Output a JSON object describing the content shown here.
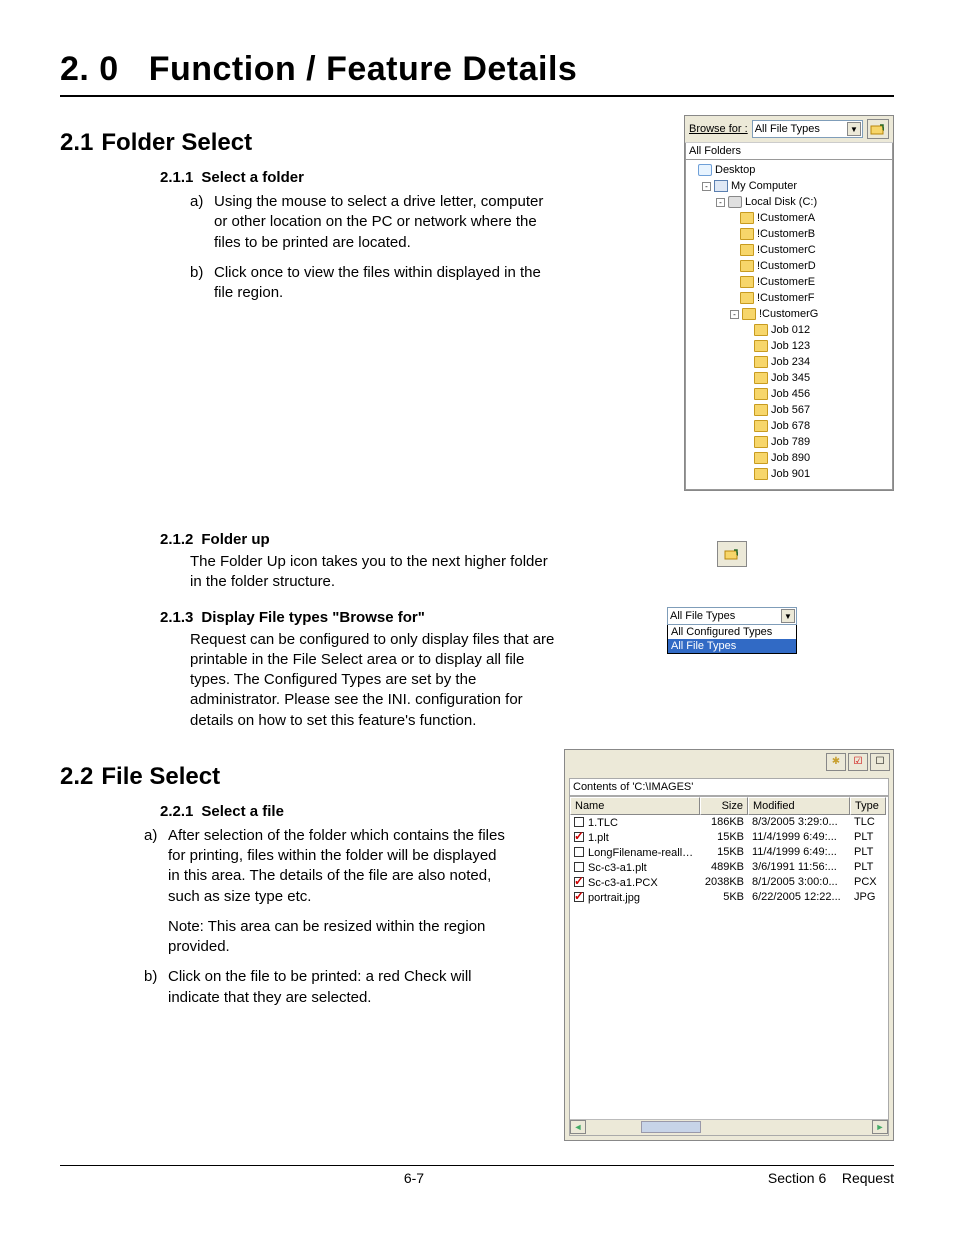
{
  "chapter": {
    "num": "2. 0",
    "title": "Function / Feature Details"
  },
  "s21": {
    "num": "2.1",
    "title": "Folder Select",
    "s211": {
      "num": "2.1.1",
      "title": "Select a folder",
      "a": "Using the mouse to select a drive letter, computer or other location on the PC or network where the files to be printed are located.",
      "b": "Click once to view the files within displayed in the file region."
    },
    "s212": {
      "num": "2.1.2",
      "title": "Folder up",
      "body": "The Folder Up icon takes you to the next higher folder in the folder structure."
    },
    "s213": {
      "num": "2.1.3",
      "title": "Display File types \"Browse for\"",
      "body": "Request can be configured to only display files that are printable in the File Select area or to display all file types. The Configured Types are set by the administrator. Please see the INI. configuration for details on how to set this feature's function."
    }
  },
  "s22": {
    "num": "2.2",
    "title": "File Select",
    "s221": {
      "num": "2.2.1",
      "title": "Select a file",
      "a": "After selection of the folder which contains the files for printing, files within the folder will be displayed in this area. The details of the file are also noted, such as size type etc.",
      "note": "Note: This area can be resized within the region provided.",
      "b": "Click on the file to be printed: a red Check will indicate that they are selected."
    }
  },
  "tree_fig": {
    "browse_label": "Browse for :",
    "dropdown_value": "All File Types",
    "section_header": "All Folders",
    "nodes": [
      {
        "depth": 0,
        "toggle": "",
        "icon": "desktop",
        "label": "Desktop"
      },
      {
        "depth": 1,
        "toggle": "-",
        "icon": "pc",
        "label": "My Computer"
      },
      {
        "depth": 2,
        "toggle": "-",
        "icon": "drive",
        "label": "Local Disk (C:)"
      },
      {
        "depth": 3,
        "toggle": "",
        "icon": "folder",
        "label": "!CustomerA"
      },
      {
        "depth": 3,
        "toggle": "",
        "icon": "folder",
        "label": "!CustomerB"
      },
      {
        "depth": 3,
        "toggle": "",
        "icon": "folder",
        "label": "!CustomerC"
      },
      {
        "depth": 3,
        "toggle": "",
        "icon": "folder",
        "label": "!CustomerD"
      },
      {
        "depth": 3,
        "toggle": "",
        "icon": "folder",
        "label": "!CustomerE"
      },
      {
        "depth": 3,
        "toggle": "",
        "icon": "folder",
        "label": "!CustomerF"
      },
      {
        "depth": 3,
        "toggle": "-",
        "icon": "folder open",
        "label": "!CustomerG"
      },
      {
        "depth": 4,
        "toggle": "",
        "icon": "folder",
        "label": "Job 012"
      },
      {
        "depth": 4,
        "toggle": "",
        "icon": "folder",
        "label": "Job 123"
      },
      {
        "depth": 4,
        "toggle": "",
        "icon": "folder",
        "label": "Job 234"
      },
      {
        "depth": 4,
        "toggle": "",
        "icon": "folder",
        "label": "Job 345"
      },
      {
        "depth": 4,
        "toggle": "",
        "icon": "folder",
        "label": "Job 456"
      },
      {
        "depth": 4,
        "toggle": "",
        "icon": "folder",
        "label": "Job 567"
      },
      {
        "depth": 4,
        "toggle": "",
        "icon": "folder",
        "label": "Job 678"
      },
      {
        "depth": 4,
        "toggle": "",
        "icon": "folder",
        "label": "Job 789"
      },
      {
        "depth": 4,
        "toggle": "",
        "icon": "folder",
        "label": "Job 890"
      },
      {
        "depth": 4,
        "toggle": "",
        "icon": "folder",
        "label": "Job 901"
      }
    ]
  },
  "dd_fig": {
    "selected": "All File Types",
    "options": [
      {
        "label": "All Configured Types",
        "hl": false
      },
      {
        "label": "All File Types",
        "hl": true
      }
    ]
  },
  "file_fig": {
    "caption": "Contents of 'C:\\IMAGES'",
    "headers": {
      "name": "Name",
      "size": "Size",
      "modified": "Modified",
      "type": "Type"
    },
    "rows": [
      {
        "checked": false,
        "name": "1.TLC",
        "size": "186KB",
        "modified": "8/3/2005 3:29:0...",
        "type": "TLC"
      },
      {
        "checked": true,
        "name": "1.plt",
        "size": "15KB",
        "modified": "11/4/1999 6:49:...",
        "type": "PLT"
      },
      {
        "checked": false,
        "name": "LongFilename-reallylo...",
        "size": "15KB",
        "modified": "11/4/1999 6:49:...",
        "type": "PLT"
      },
      {
        "checked": false,
        "name": "Sc-c3-a1.plt",
        "size": "489KB",
        "modified": "3/6/1991 11:56:...",
        "type": "PLT"
      },
      {
        "checked": true,
        "name": "Sc-c3-a1.PCX",
        "size": "2038KB",
        "modified": "8/1/2005 3:00:0...",
        "type": "PCX"
      },
      {
        "checked": true,
        "name": "portrait.jpg",
        "size": "5KB",
        "modified": "6/22/2005 12:22...",
        "type": "JPG"
      }
    ]
  },
  "markers": {
    "a": "a)",
    "b": "b)"
  },
  "footer": {
    "left": "6-7",
    "right_section": "Section 6",
    "right_title": "Request"
  }
}
